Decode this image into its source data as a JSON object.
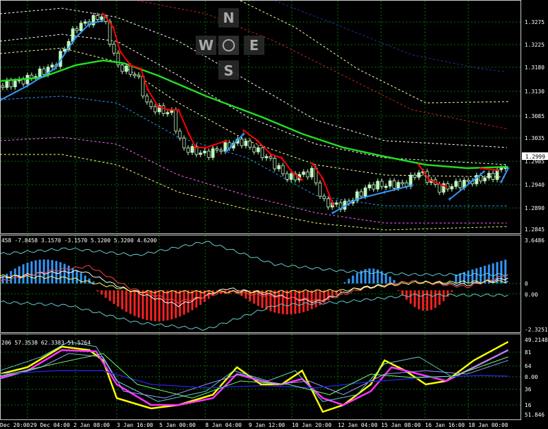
{
  "colors": {
    "background": "#000000",
    "grid": "#00a000",
    "axis": "#ffffff",
    "bull_candle": "#b8ffb8",
    "bear_candle": "#000000",
    "ma_green": "#22dd22",
    "trail_red": "#ff0000",
    "trail_blue": "#3399ff",
    "macd_pos": "#3399ff",
    "macd_neg": "#ff2222",
    "stoch_yellow": "#ffff00",
    "stoch_magenta": "#ff33ff"
  },
  "compass": {
    "n": "N",
    "w": "W",
    "e": "E",
    "s": "S"
  },
  "price_axis": {
    "labels": [
      "1.3275",
      "1.3225",
      "1.3180",
      "1.3130",
      "1.3085",
      "1.3035",
      "1.2985",
      "1.2940",
      "1.2890",
      "1.2845"
    ],
    "current": "1.2999"
  },
  "macd_panel": {
    "header": "458 -7.8458 3.1570 -3.1570 5.1200 5.3200 4.6200",
    "labels": [
      "3.6486",
      "0",
      "0.00",
      "-2.3251"
    ]
  },
  "stoch_panel": {
    "header": "206 57.3538 62.3383 51.5264",
    "labels": [
      "49.2148",
      "81",
      "64",
      "0.00",
      "36",
      "16",
      "51.846"
    ]
  },
  "time_axis": {
    "labels": [
      "Dec 20:00",
      "29 Dec 04:00",
      "2 Jan 08:00",
      "3 Jan 16:00",
      "5 Jan 00:00",
      "8 Jan 04:00",
      "9 Jan 12:00",
      "10 Jan 20:00",
      "12 Jan 04:00",
      "15 Jan 08:00",
      "16 Jan 16:00",
      "18 Jan 00:00"
    ]
  }
}
